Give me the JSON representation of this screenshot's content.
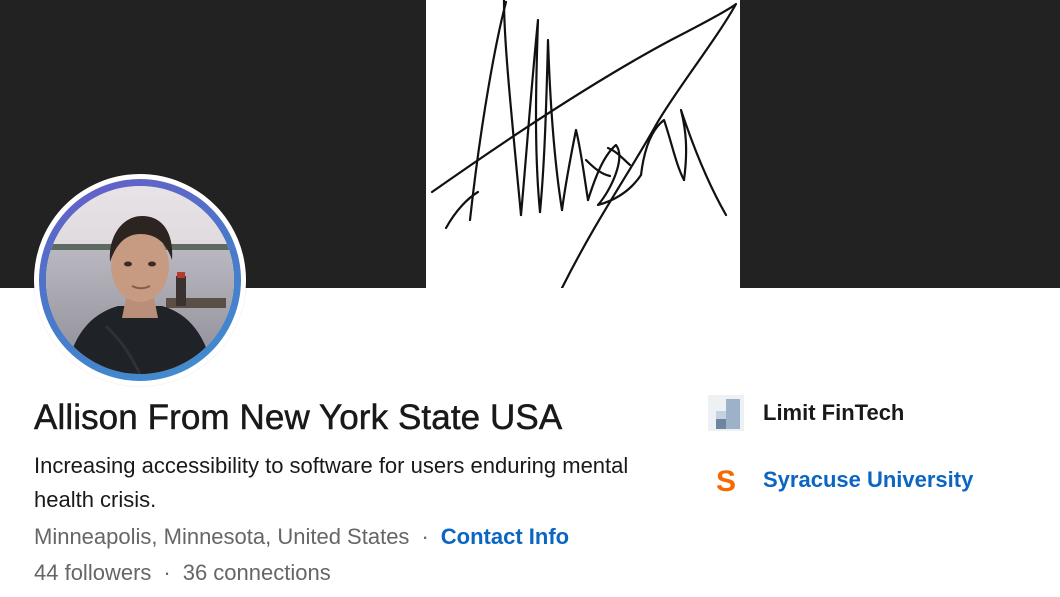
{
  "cover": {
    "background_color": "#222222",
    "panel_color": "#ffffff",
    "signature_label": "Allison"
  },
  "profile": {
    "name": "Allison From New York State USA",
    "headline": "Increasing accessibility to software for users enduring mental health crisis.",
    "location": "Minneapolis, Minnesota, United States",
    "separator": "·",
    "contact_info_label": "Contact Info",
    "followers": "44 followers",
    "connections": "36 connections"
  },
  "orgs": [
    {
      "name": "Limit FinTech",
      "icon": "company-logo-icon"
    },
    {
      "name": "Syracuse University",
      "icon": "syracuse-logo-icon",
      "logo_letter": "S"
    }
  ],
  "colors": {
    "link": "#0a66c2",
    "secondary_text": "#666666",
    "primary_text": "#191919",
    "avatar_ring_start": "#6a5bc8",
    "avatar_ring_end": "#3f8fd0",
    "syracuse_orange": "#f76900"
  }
}
